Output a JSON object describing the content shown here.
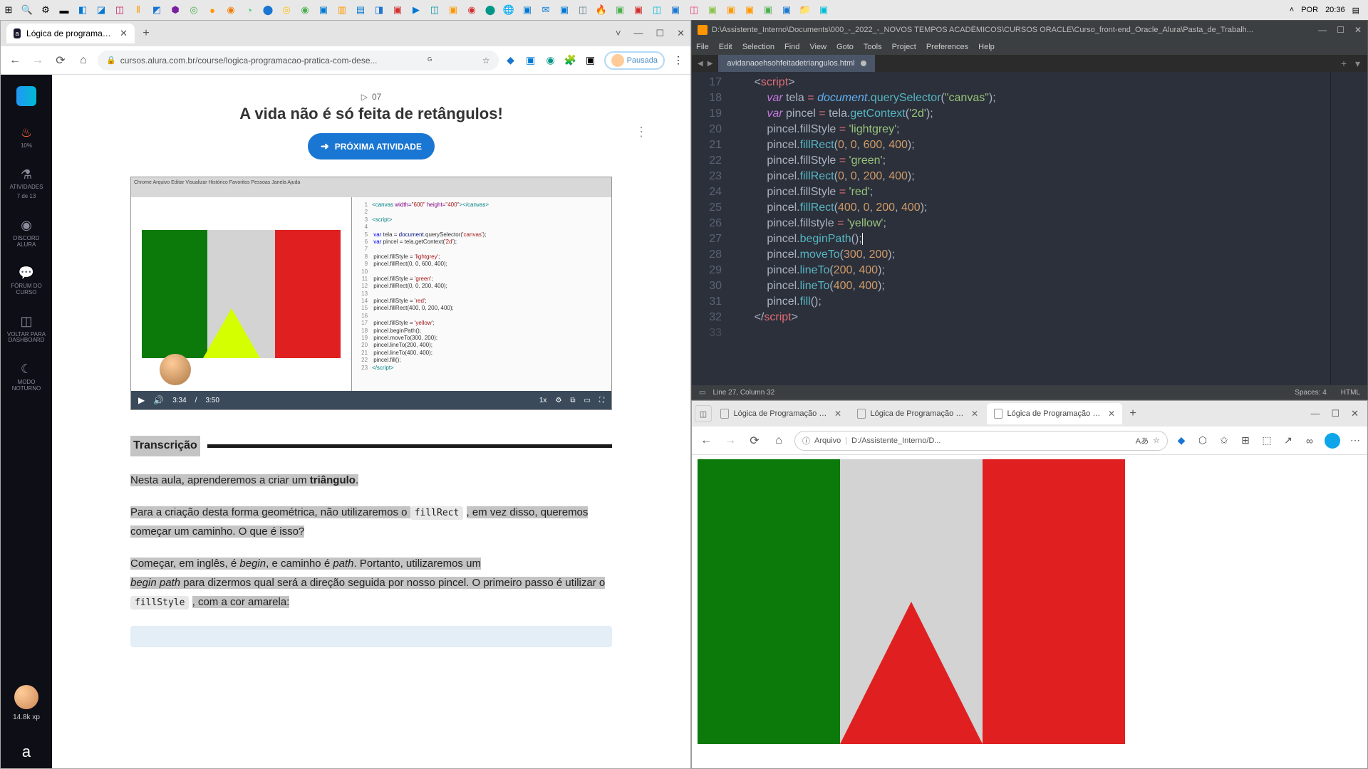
{
  "taskbar": {
    "lang": "POR",
    "time": "20:36"
  },
  "chrome": {
    "tab_title": "Lógica de programação II: pratic",
    "url": "cursos.alura.com.br/course/logica-programacao-pratica-com-dese...",
    "pause_label": "Pausada",
    "sidebar": {
      "progress": "10%",
      "atividades": "ATIVIDADES",
      "atividades_sub": "7 de 13",
      "discord": "DISCORD ALURA",
      "forum": "FÓRUM DO CURSO",
      "voltar": "VOLTAR PARA DASHBOARD",
      "modo": "MODO NOTURNO",
      "xp": "14.8k xp"
    },
    "lesson": {
      "num": "07",
      "title": "A vida não é só feita de retângulos!",
      "next": "PRÓXIMA ATIVIDADE"
    },
    "video": {
      "current": "3:34",
      "total": "3:50",
      "speed": "1x"
    },
    "transcript": {
      "heading": "Transcrição",
      "p1_a": "Nesta aula, aprenderemos a criar um ",
      "p1_b": "triângulo",
      "p2_a": "Para a criação desta forma geométrica, não utilizaremos o ",
      "p2_code": "fillRect",
      "p2_b": " , em vez disso, queremos começar um caminho. O que é isso?",
      "p3_a": "Começar, em inglês, é ",
      "p3_i1": "begin",
      "p3_b": ", e caminho é ",
      "p3_i2": "path",
      "p3_c": ". Portanto, utilizaremos um ",
      "p3_i3": "begin path",
      "p3_d": " para dizermos qual será a direção seguida por nosso pincel. O primeiro passo é utilizar o ",
      "p3_code": "fillStyle",
      "p3_e": " , com a cor amarela:"
    }
  },
  "sublime": {
    "path": "D:\\Assistente_Interno\\Documents\\000_-_2022_-_NOVOS TEMPOS ACADÊMICOS\\CURSOS ORACLE\\Curso_front-end_Oracle_Alura\\Pasta_de_Trabalh...",
    "menu": [
      "File",
      "Edit",
      "Selection",
      "Find",
      "View",
      "Goto",
      "Tools",
      "Project",
      "Preferences",
      "Help"
    ],
    "tab": "avidanaoehsohfeitadetriangulos.html",
    "lines": [
      "17",
      "18",
      "19",
      "20",
      "21",
      "22",
      "23",
      "24",
      "25",
      "26",
      "27",
      "28",
      "29",
      "30",
      "31",
      "32",
      "33"
    ],
    "status": "Line 27, Column 32",
    "spaces": "Spaces: 4",
    "lang": "HTML"
  },
  "edge": {
    "tab1": "Lógica de Programação com Ja",
    "tab2": "Lógica de Programação com Ja",
    "tab3": "Lógica de Programação com Ja",
    "url_label": "Arquivo",
    "url_path": "D:/Assistente_Interno/D..."
  }
}
